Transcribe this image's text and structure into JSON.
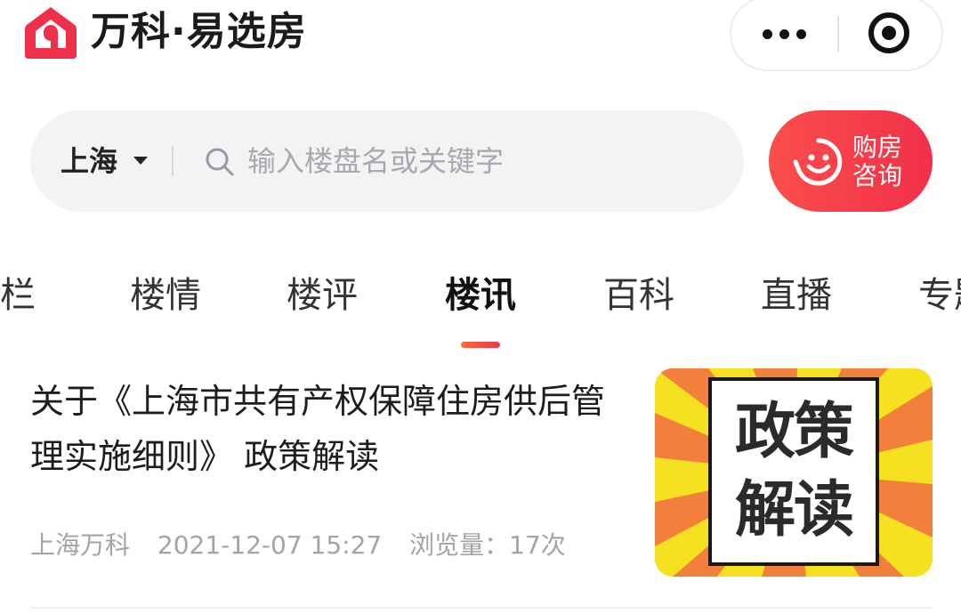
{
  "header": {
    "brand": "万科·易选房",
    "colors": {
      "brand_red": "#f0304a"
    }
  },
  "capsule": {
    "more_icon": "more-dots-icon",
    "close_icon": "target-circle-icon"
  },
  "search": {
    "city": "上海",
    "placeholder": "输入楼盘名或关键字"
  },
  "consult": {
    "line1": "购房",
    "line2": "咨询"
  },
  "tabs": [
    {
      "label": "专栏"
    },
    {
      "label": "楼情"
    },
    {
      "label": "楼评"
    },
    {
      "label": "楼讯",
      "active": true
    },
    {
      "label": "百科"
    },
    {
      "label": "直播"
    },
    {
      "label": "专题"
    }
  ],
  "article": {
    "title": "关于《上海市共有产权保障住房供后管理实施细则》 政策解读",
    "source": "上海万科",
    "datetime": "2021-12-07 15:27",
    "views": "浏览量：17次",
    "thumb_line1": "政策",
    "thumb_line2": "解读"
  }
}
